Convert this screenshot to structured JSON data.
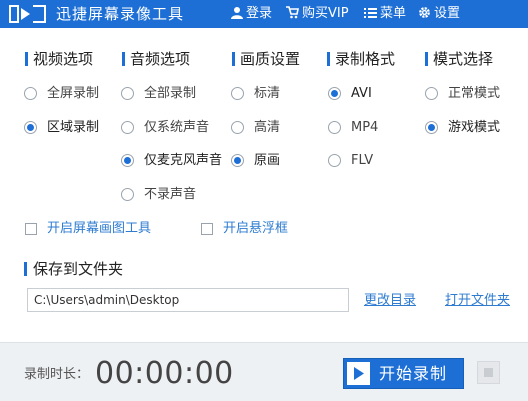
{
  "app": {
    "title": "迅捷屏幕录像工具"
  },
  "titlebar": {
    "login": "登录",
    "buy_vip": "购买VIP",
    "menu": "菜单",
    "settings": "设置"
  },
  "colors": {
    "accent": "#1d6fd6",
    "link": "#2e7bd0",
    "bottom_bar": "#eef1f4"
  },
  "sections": {
    "video": {
      "header": "视频选项",
      "options": [
        "全屏录制",
        "区域录制"
      ],
      "selected": "区域录制"
    },
    "audio": {
      "header": "音频选项",
      "options": [
        "全部录制",
        "仅系统声音",
        "仅麦克风声音",
        "不录声音"
      ],
      "selected": "仅麦克风声音"
    },
    "quality": {
      "header": "画质设置",
      "options": [
        "标清",
        "高清",
        "原画"
      ],
      "selected": "原画"
    },
    "format": {
      "header": "录制格式",
      "options": [
        "AVI",
        "MP4",
        "FLV"
      ],
      "selected": "AVI"
    },
    "mode": {
      "header": "模式选择",
      "options": [
        "正常模式",
        "游戏模式"
      ],
      "selected": "游戏模式"
    }
  },
  "checkboxes": {
    "draw_tool": {
      "label": "开启屏幕画图工具",
      "checked": false
    },
    "float_box": {
      "label": "开启悬浮框",
      "checked": false
    }
  },
  "save": {
    "header": "保存到文件夹",
    "path": "C:\\Users\\admin\\Desktop",
    "change_dir": "更改目录",
    "open_folder": "打开文件夹"
  },
  "bottom": {
    "duration_label": "录制时长：",
    "timer": "00:00:00",
    "start_label": "开始录制"
  },
  "icons": [
    "logo-icon",
    "user-icon",
    "cart-icon",
    "menu-icon",
    "gear-icon",
    "play-icon",
    "stop-icon"
  ]
}
